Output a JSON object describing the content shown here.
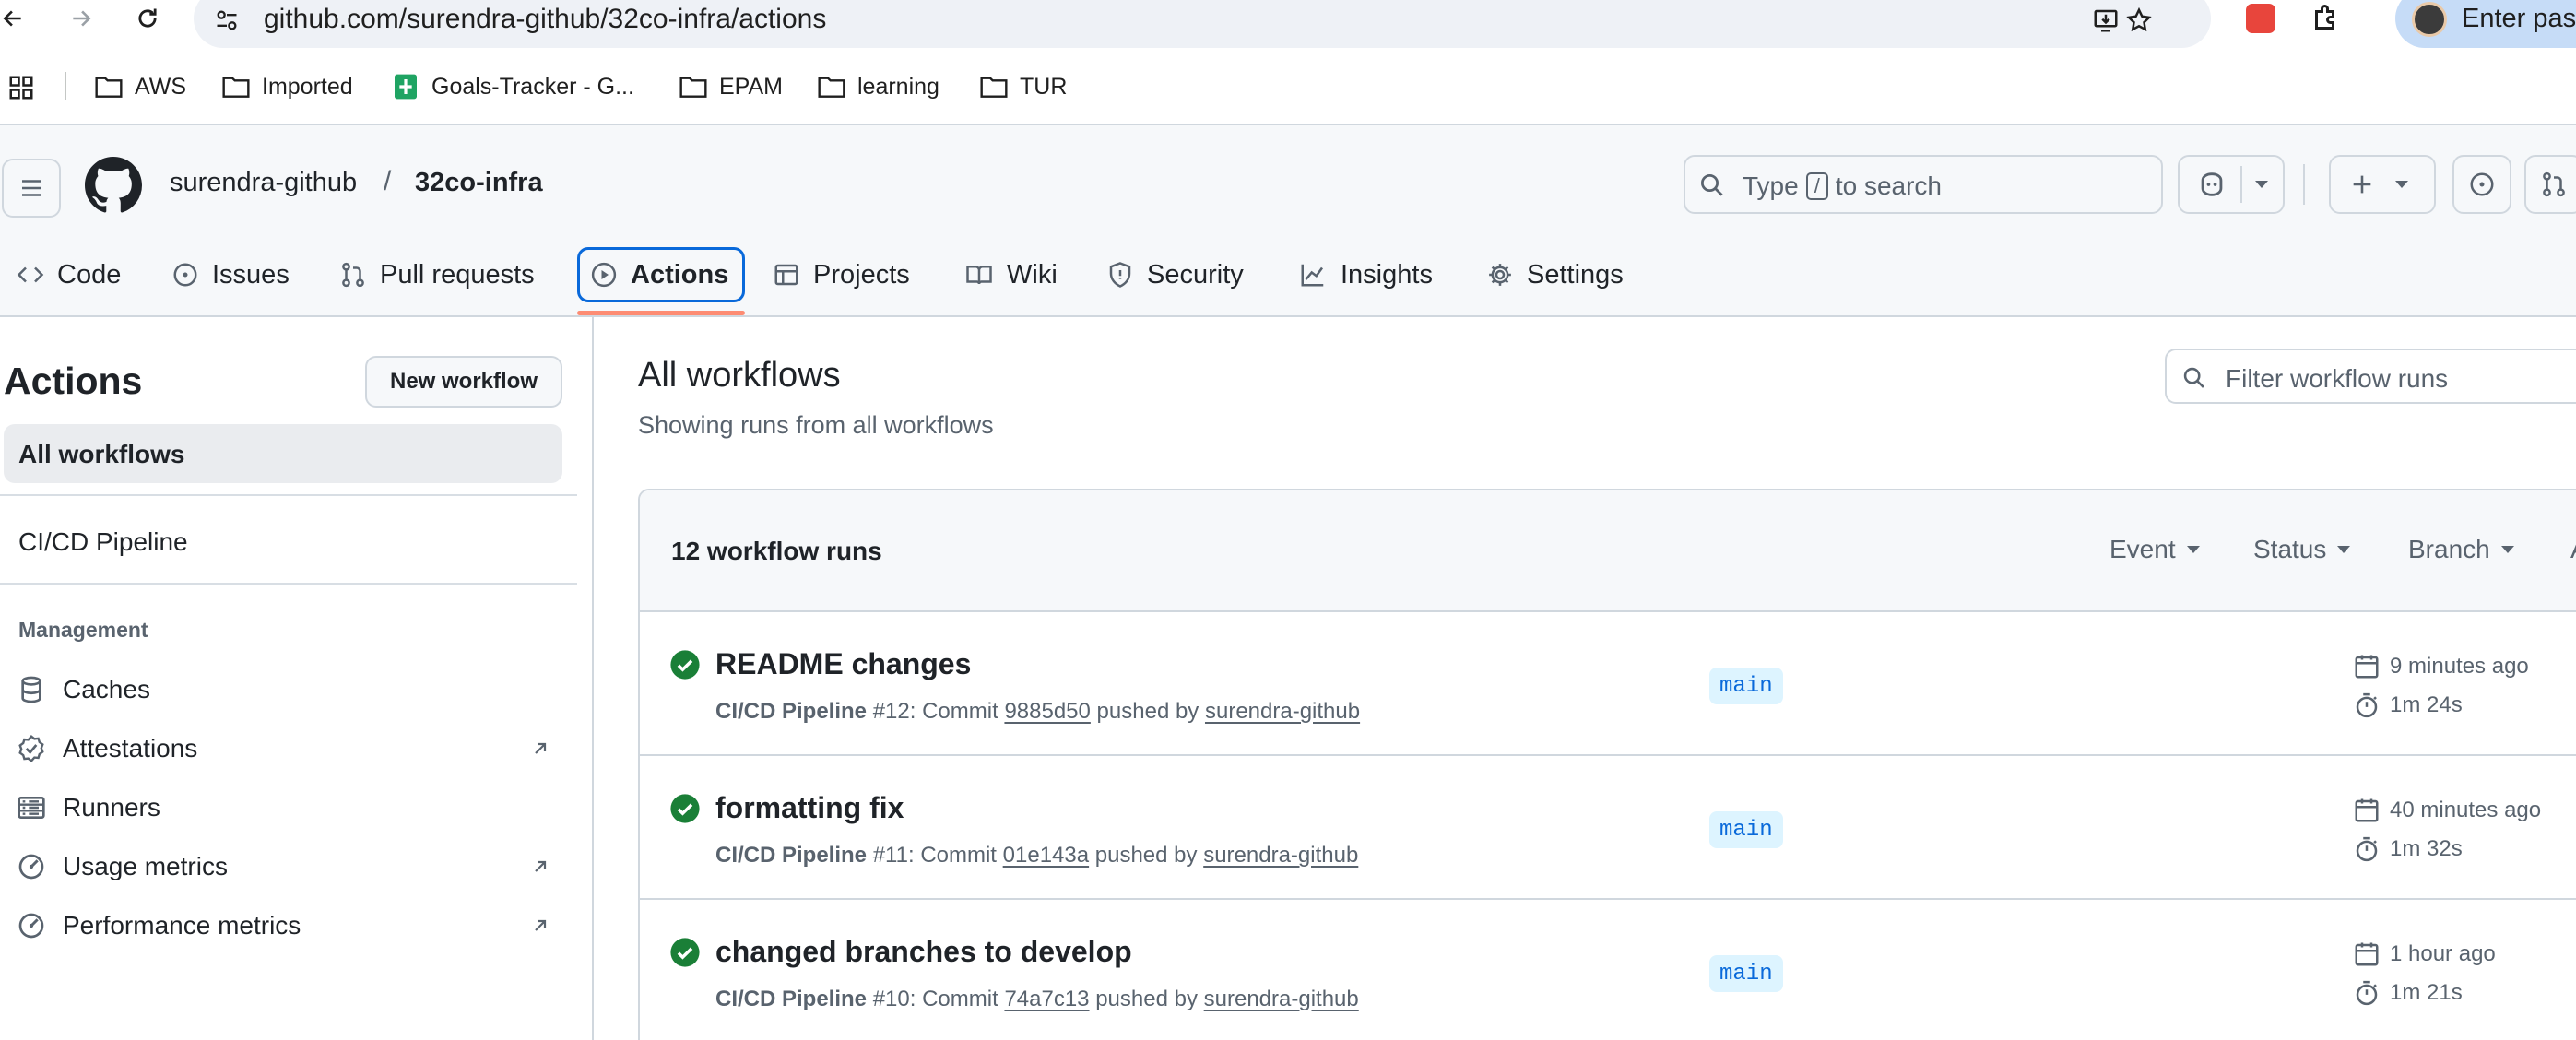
{
  "browser": {
    "url": "github.com/surendra-github/32co-infra/actions",
    "profile_label": "Enter pass"
  },
  "bookmarks": [
    {
      "label": "AWS",
      "icon": "folder-icon"
    },
    {
      "label": "Imported",
      "icon": "folder-icon"
    },
    {
      "label": "Goals-Tracker - G...",
      "icon": "sheets-icon"
    },
    {
      "label": "EPAM",
      "icon": "folder-icon"
    },
    {
      "label": "learning",
      "icon": "folder-icon"
    },
    {
      "label": "TUR",
      "icon": "folder-icon"
    }
  ],
  "header": {
    "owner": "surendra-github",
    "separator": "/",
    "repo": "32co-infra",
    "search_prefix": "Type",
    "search_key": "/",
    "search_suffix": "to search"
  },
  "repo_tabs": [
    {
      "label": "Code",
      "icon": "code-icon"
    },
    {
      "label": "Issues",
      "icon": "issue-icon"
    },
    {
      "label": "Pull requests",
      "icon": "pull-request-icon"
    },
    {
      "label": "Actions",
      "icon": "play-icon",
      "selected": true
    },
    {
      "label": "Projects",
      "icon": "table-icon"
    },
    {
      "label": "Wiki",
      "icon": "book-icon"
    },
    {
      "label": "Security",
      "icon": "shield-icon"
    },
    {
      "label": "Insights",
      "icon": "graph-icon"
    },
    {
      "label": "Settings",
      "icon": "gear-icon"
    }
  ],
  "sidebar": {
    "title": "Actions",
    "new_workflow": "New workflow",
    "all_workflows": "All workflows",
    "workflows": [
      "CI/CD Pipeline"
    ],
    "management_heading": "Management",
    "management_items": [
      {
        "label": "Caches",
        "icon": "database-icon",
        "external": false
      },
      {
        "label": "Attestations",
        "icon": "verified-icon",
        "external": true
      },
      {
        "label": "Runners",
        "icon": "server-icon",
        "external": false
      },
      {
        "label": "Usage metrics",
        "icon": "meter-icon",
        "external": true
      },
      {
        "label": "Performance metrics",
        "icon": "meter-icon",
        "external": true
      }
    ]
  },
  "main": {
    "title": "All workflows",
    "subtitle": "Showing runs from all workflows",
    "filter_placeholder": "Filter workflow runs",
    "runs_count": "12 workflow runs",
    "filters": [
      "Event",
      "Status",
      "Branch",
      "A"
    ],
    "runs": [
      {
        "title": "README changes",
        "workflow": "CI/CD Pipeline",
        "number": "#12",
        "commit": "9885d50",
        "actor": "surendra-github",
        "branch": "main",
        "when": "9 minutes ago",
        "duration": "1m 24s",
        "status": "success"
      },
      {
        "title": "formatting fix",
        "workflow": "CI/CD Pipeline",
        "number": "#11",
        "commit": "01e143a",
        "actor": "surendra-github",
        "branch": "main",
        "when": "40 minutes ago",
        "duration": "1m 32s",
        "status": "success"
      },
      {
        "title": "changed branches to develop",
        "workflow": "CI/CD Pipeline",
        "number": "#10",
        "commit": "74a7c13",
        "actor": "surendra-github",
        "branch": "main",
        "when": "1 hour ago",
        "duration": "1m 21s",
        "status": "success"
      }
    ],
    "text_commit": "Commit",
    "text_pushed_by": "pushed by"
  },
  "colors": {
    "success": "#1a7f37",
    "accent": "#0969da",
    "tab_underline": "#fd8c73"
  }
}
